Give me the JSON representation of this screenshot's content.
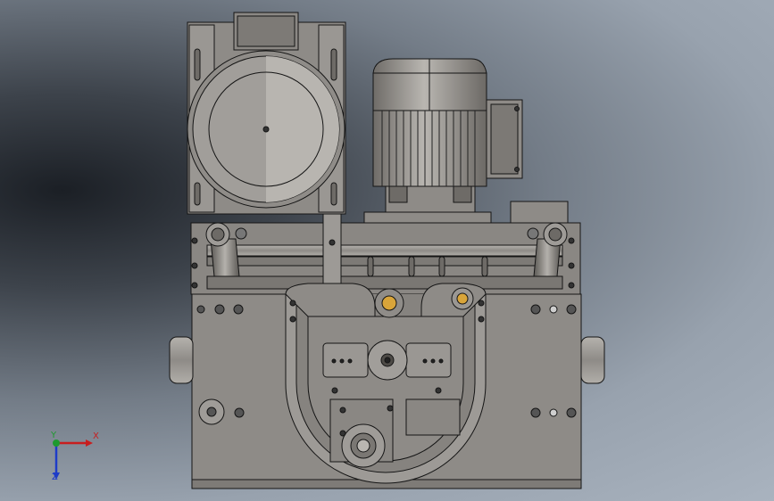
{
  "viewport": {
    "colors": {
      "part_fill": "#8e8b87",
      "part_fill_light": "#a9a6a2",
      "part_fill_dark": "#5f5c58",
      "edge_line": "#151515"
    }
  },
  "triad": {
    "x_label": "X",
    "y_label": "Y",
    "z_label": "Z",
    "colors": {
      "x": "#c81e1e",
      "y": "#1e9a2e",
      "z": "#1e3cc8"
    }
  }
}
